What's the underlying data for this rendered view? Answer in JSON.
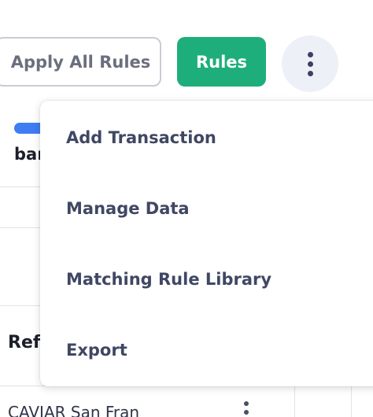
{
  "toolbar": {
    "apply_all_rules_label": "Apply All Rules",
    "rules_label": "Rules",
    "more_icon": "vertical-ellipsis"
  },
  "background": {
    "truncated_text_top": "bar",
    "column_header_partial": "Ref",
    "row_text_partial": "CAVIAR San Fran"
  },
  "menu": {
    "items": [
      {
        "label": "Add Transaction"
      },
      {
        "label": "Manage Data"
      },
      {
        "label": "Matching Rule Library"
      },
      {
        "label": "Export"
      }
    ]
  },
  "colors": {
    "primary_green": "#1eae7b",
    "accent_blue": "#3f7df3",
    "menu_text": "#404763",
    "kebab_bg": "#eef0f8"
  }
}
